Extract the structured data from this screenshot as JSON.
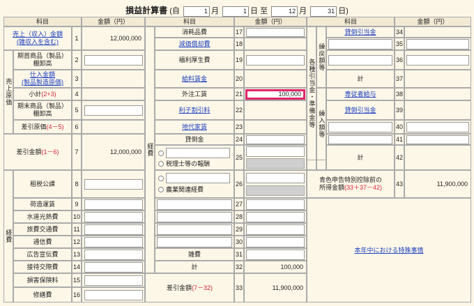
{
  "header": {
    "title": "損益計算書",
    "open": "(自",
    "m1": "1",
    "mk1": "月",
    "d1": "1",
    "dk1": "日",
    "to": "至",
    "m2": "12",
    "mk2": "月",
    "d2": "31",
    "dk2": "日)"
  },
  "col": {
    "item": "科目",
    "amt": "金額（円）"
  },
  "c1": {
    "sales": "売上（収入）金額",
    "sales2": "(雑収入を含む)",
    "sales_v": "12,000,000",
    "kisho": "期首商品（製品）",
    "kisho2": "棚卸高",
    "cogs": "売上原価",
    "shiire": "仕入金額",
    "shiire2": "(製品製造原価)",
    "shokei": "小計",
    "shokei_f": "(2+3)",
    "kimatsu": "期末商品（製品）",
    "kimatsu2": "棚卸高",
    "sashi": "差引原価",
    "sashi_f": "(4－5)",
    "arari": "差引金額",
    "arari_f": "(1－6)",
    "arari_v": "12,000,000",
    "keihi": "経費",
    "sozei": "租税公課",
    "nizukuri": "荷造運賃",
    "suido": "水道光熱費",
    "ryohi": "旅費交通費",
    "tsushin": "通信費",
    "kokoku": "広告宣伝費",
    "settai": "接待交際費",
    "songai": "損害保険料",
    "shuzen": "修繕費"
  },
  "c2": {
    "keihi": "経費",
    "shomo": "消耗品費",
    "genka": "減価償却費",
    "fukuri": "福利厚生費",
    "kyuryo": "給料賃金",
    "gaichu": "外注工賃",
    "gaichu_v": "100,000",
    "rishi": "利子割引料",
    "chidai": "地代家賃",
    "kashi": "貸倒金",
    "zeiri": "税理士等の報酬",
    "nokyo": "農業関連経費",
    "zappi": "雑費",
    "kei": "計",
    "kei_v": "100,000",
    "sashi": "差引金額",
    "sashi_f": "(7－32)",
    "sashi_v": "11,900,000"
  },
  "c3": {
    "kuri": "繰戻額等",
    "kakushu": "各種引当金・準備金等",
    "kasho1": "貸倒引当金",
    "kei": "計",
    "senjusha": "専従者給与",
    "kuriire": "繰入額等",
    "kasho2": "貸倒引当金",
    "kei2": "計",
    "aoiro": "青色申告特別控除前の",
    "aoiro2": "所得金額",
    "aoiro_f": "(33＋37－42)",
    "aoiro_v": "11,900,000",
    "tokushu": "本年中における特殊事情"
  },
  "nums": {
    "n1": "1",
    "n2": "2",
    "n3": "3",
    "n4": "4",
    "n5": "5",
    "n6": "6",
    "n7": "7",
    "n8": "8",
    "n9": "9",
    "n10": "10",
    "n11": "11",
    "n12": "12",
    "n13": "13",
    "n14": "14",
    "n15": "15",
    "n16": "16",
    "n17": "17",
    "n18": "18",
    "n19": "19",
    "n20": "20",
    "n21": "21",
    "n22": "22",
    "n23": "23",
    "n24": "24",
    "n25": "25",
    "n26": "26",
    "n27": "27",
    "n28": "28",
    "n29": "29",
    "n30": "30",
    "n31": "31",
    "n32": "32",
    "n33": "33",
    "n34": "34",
    "n35": "35",
    "n36": "36",
    "n37": "37",
    "n38": "38",
    "n39": "39",
    "n40": "40",
    "n41": "41",
    "n42": "42",
    "n43": "43"
  }
}
